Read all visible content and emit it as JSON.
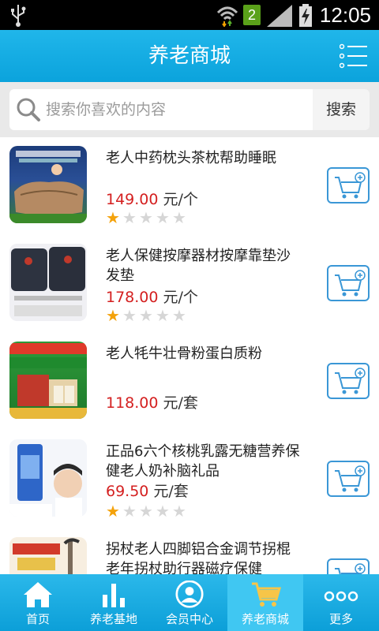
{
  "status": {
    "time": "12:05",
    "sim": "2"
  },
  "header": {
    "title": "养老商城"
  },
  "search": {
    "placeholder": "搜索你喜欢的内容",
    "button": "搜索"
  },
  "products": [
    {
      "name": "老人中药枕头茶枕帮助睡眠",
      "price": "149.00",
      "unit": "元/个",
      "rating": 1
    },
    {
      "name": "老人保健按摩器材按摩靠垫沙发垫",
      "price": "178.00",
      "unit": "元/个",
      "rating": 1
    },
    {
      "name": "老人牦牛壮骨粉蛋白质粉",
      "price": "118.00",
      "unit": "元/套",
      "rating": null
    },
    {
      "name": "正品6六个核桃乳露无糖营养保健老人奶补脑礼品",
      "price": "69.50",
      "unit": "元/套",
      "rating": 1
    },
    {
      "name": "拐杖老人四脚铝合金调节拐棍老年拐杖助行器磁疗保健",
      "price": "",
      "unit": "",
      "rating": null
    }
  ],
  "tabs": [
    {
      "label": "首页",
      "icon": "home-icon"
    },
    {
      "label": "养老基地",
      "icon": "bar-chart-icon"
    },
    {
      "label": "会员中心",
      "icon": "user-icon"
    },
    {
      "label": "养老商城",
      "icon": "cart-icon",
      "active": true
    },
    {
      "label": "更多",
      "icon": "more-icon"
    }
  ],
  "colors": {
    "accent": "#0ba3dc",
    "price": "#d42020",
    "star": "#f4a20b"
  }
}
